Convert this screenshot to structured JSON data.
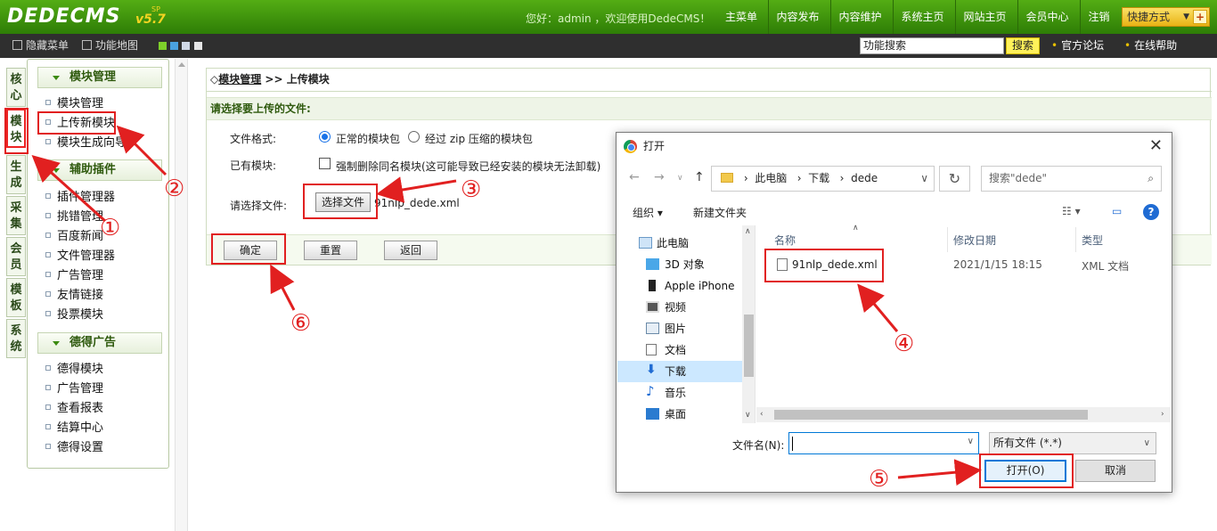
{
  "header": {
    "logo": "DEDECMS",
    "version": "v5.7",
    "version_tag": "SP",
    "welcome": "您好：admin ，欢迎使用DedeCMS！",
    "nav": [
      "主菜单",
      "内容发布",
      "内容维护",
      "系统主页",
      "网站主页",
      "会员中心",
      "注销"
    ],
    "quick": "快捷方式"
  },
  "subbar": {
    "hide_menu": "隐藏菜单",
    "feature_map": "功能地图",
    "search_value": "功能搜索",
    "search_btn": "搜索",
    "forum": "官方论坛",
    "help": "在线帮助"
  },
  "vtabs": [
    "核心",
    "模块",
    "生成",
    "采集",
    "会员",
    "模板",
    "系统"
  ],
  "sidebar": {
    "groups": [
      {
        "title": "模块管理",
        "items": [
          "模块管理",
          "上传新模块",
          "模块生成向导"
        ]
      },
      {
        "title": "辅助插件",
        "items": [
          "插件管理器",
          "挑错管理",
          "百度新闻",
          "文件管理器",
          "广告管理",
          "友情链接",
          "投票模块"
        ]
      },
      {
        "title": "德得广告",
        "items": [
          "德得模块",
          "广告管理",
          "查看报表",
          "结算中心",
          "德得设置"
        ]
      }
    ]
  },
  "main": {
    "crumb_prefix": "◇",
    "crumb_link": "模块管理",
    "crumb_rest": " >> 上传模块",
    "section_title": "请选择要上传的文件:",
    "format_label": "文件格式:",
    "format_opt1": "正常的模块包",
    "format_opt2": "经过 zip 压缩的模块包",
    "exists_label": "已有模块:",
    "exists_opt": "强制删除同名模块(这可能导致已经安装的模块无法卸载)",
    "file_label": "请选择文件:",
    "choose_btn": "选择文件",
    "chosen_file": "91nlp_dede.xml",
    "ok": "确定",
    "reset": "重置",
    "back": "返回"
  },
  "dialog": {
    "title": "打开",
    "path": [
      "此电脑",
      "下载",
      "dede"
    ],
    "search_placeholder": "搜索\"dede\"",
    "organize": "组织 ▾",
    "new_folder": "新建文件夹",
    "nav_items": [
      "此电脑",
      "3D 对象",
      "Apple iPhone",
      "视频",
      "图片",
      "文档",
      "下载",
      "音乐",
      "桌面"
    ],
    "columns": [
      "名称",
      "修改日期",
      "类型"
    ],
    "file": {
      "name": "91nlp_dede.xml",
      "date": "2021/1/15 18:15",
      "type": "XML 文档"
    },
    "filename_label": "文件名(N):",
    "filetype": "所有文件 (*.*)",
    "open": "打开(O)",
    "cancel": "取消"
  },
  "annotations": [
    "①",
    "②",
    "③",
    "④",
    "⑤",
    "⑥"
  ]
}
